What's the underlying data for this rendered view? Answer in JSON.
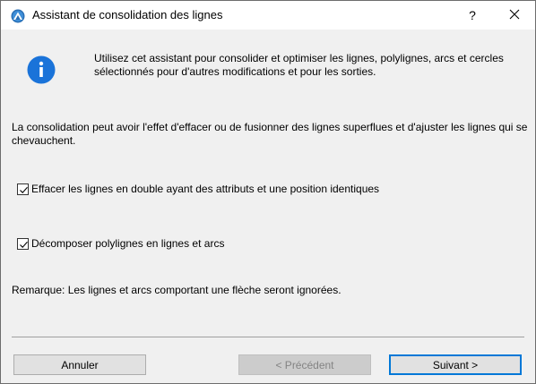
{
  "window": {
    "title": "Assistant de consolidation des lignes",
    "help_label": "?",
    "close_label": "✕"
  },
  "content": {
    "intro": "Utilisez cet assistant pour consolider et optimiser les lignes, polylignes, arcs et cercles sélectionnés pour d'autres modifications et pour les sorties.",
    "description": "La consolidation peut avoir l'effet d'effacer ou de fusionner des lignes superflues et d'ajuster les lignes qui se chevauchent.",
    "options": [
      {
        "label": "Effacer les lignes en double ayant des attributs et une position identiques",
        "checked": true
      },
      {
        "label": "Décomposer polylignes en lignes et arcs",
        "checked": true
      }
    ],
    "note": "Remarque: Les lignes et arcs comportant une flèche seront ignorées."
  },
  "buttons": {
    "cancel": "Annuler",
    "previous": "< Précédent",
    "next": "Suivant >"
  },
  "icons": {
    "app": "archicad-app-icon",
    "info": "info-icon"
  },
  "colors": {
    "dialog_bg": "#f0f0f0",
    "titlebar_bg": "#ffffff",
    "info_blue": "#1a73d9",
    "default_button_border": "#0078d7",
    "disabled_text": "#838383"
  }
}
